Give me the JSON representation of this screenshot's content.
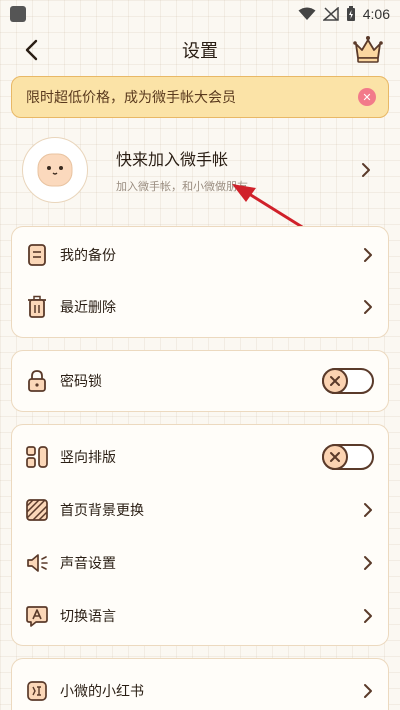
{
  "status_bar": {
    "time": "4:06"
  },
  "header": {
    "title": "设置"
  },
  "promo": {
    "text": "限时超低价格，成为微手帐大会员"
  },
  "profile": {
    "title": "快来加入微手帐",
    "subtitle": "加入微手帐，和小微做朋友"
  },
  "sections": {
    "backup": {
      "my_backup": "我的备份",
      "recent_deleted": "最近删除"
    },
    "security": {
      "password_lock": "密码锁",
      "password_lock_on": false
    },
    "display": {
      "vertical_layout": "竖向排版",
      "vertical_layout_on": false,
      "home_background": "首页背景更换",
      "sound_settings": "声音设置",
      "switch_language": "切换语言"
    },
    "social": {
      "xiaohongshu": "小微的小红书"
    }
  },
  "colors": {
    "accent_border": "#ecd9bf",
    "promo_bg": "#fbe3a7",
    "close_badge": "#f27a8a",
    "annotation_arrow": "#d0212a"
  }
}
